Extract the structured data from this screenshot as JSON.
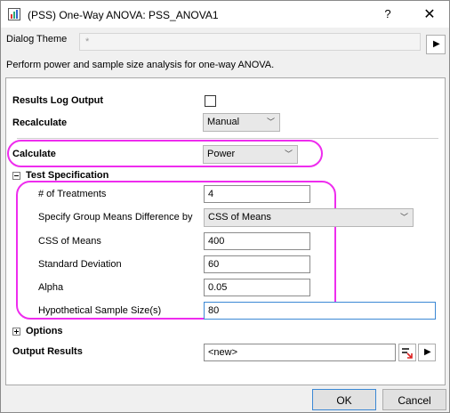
{
  "window": {
    "title": "(PSS) One-Way ANOVA: PSS_ANOVA1",
    "help_glyph": "?",
    "close_glyph": "✕"
  },
  "theme": {
    "label": "Dialog Theme",
    "value": "*",
    "menu_glyph": "▶"
  },
  "description": "Perform power and sample size analysis for one-way ANOVA.",
  "form": {
    "results_log_label": "Results Log Output",
    "results_log_checked": false,
    "recalculate_label": "Recalculate",
    "recalculate_value": "Manual",
    "calculate_label": "Calculate",
    "calculate_value": "Power",
    "test_spec_label": "Test Specification",
    "treatments_label": "# of Treatments",
    "treatments_value": "4",
    "means_diff_label": "Specify Group Means Difference by",
    "means_diff_value": "CSS of Means",
    "css_label": "CSS of Means",
    "css_value": "400",
    "std_label": "Standard Deviation",
    "std_value": "60",
    "alpha_label": "Alpha",
    "alpha_value": "0.05",
    "sample_size_label": "Hypothetical Sample Size(s)",
    "sample_size_value": "80",
    "options_label": "Options",
    "output_label": "Output Results",
    "output_value": "<new>",
    "output_menu_glyph": "▶"
  },
  "buttons": {
    "ok": "OK",
    "cancel": "Cancel"
  },
  "colors": {
    "highlight": "#ee2cee",
    "focus_border": "#3b88d4"
  }
}
